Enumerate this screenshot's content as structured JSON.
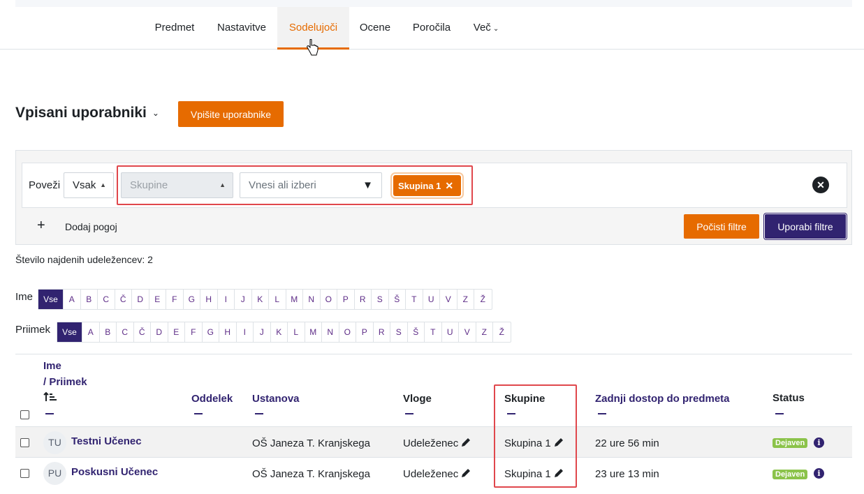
{
  "nav": {
    "tabs": [
      {
        "label": "Predmet"
      },
      {
        "label": "Nastavitve"
      },
      {
        "label": "Sodelujoči"
      },
      {
        "label": "Ocene"
      },
      {
        "label": "Poročila"
      },
      {
        "label": "Več"
      }
    ],
    "active": "Sodelujoči"
  },
  "page": {
    "title": "Vpisani uporabniki",
    "enrol_button": "Vpišite uporabnike"
  },
  "filters": {
    "match_label": "Poveži",
    "match_value": "Vsak",
    "type_value": "Skupine",
    "input_placeholder": "Vnesi ali izberi",
    "selected_chip": "Skupina 1",
    "add_condition": "Dodaj pogoj",
    "clear_button": "Počisti filtre",
    "apply_button": "Uporabi filtre"
  },
  "count_text": "Število najdenih udeležencev: 2",
  "initials": {
    "first_label": "Ime",
    "last_label": "Priimek",
    "all": "Vse",
    "letters": [
      "A",
      "B",
      "C",
      "Č",
      "D",
      "E",
      "F",
      "G",
      "H",
      "I",
      "J",
      "K",
      "L",
      "M",
      "N",
      "O",
      "P",
      "R",
      "S",
      "Š",
      "T",
      "U",
      "V",
      "Z",
      "Ž"
    ]
  },
  "table": {
    "headers": {
      "name_first": "Ime",
      "name_last": "/ Priimek",
      "department": "Oddelek",
      "institution": "Ustanova",
      "roles": "Vloge",
      "groups": "Skupine",
      "last_access": "Zadnji dostop do predmeta",
      "status": "Status"
    },
    "rows": [
      {
        "initials": "TU",
        "name": "Testni Učenec",
        "institution": "OŠ Janeza T. Kranjskega",
        "role": "Udeleženec",
        "group": "Skupina 1",
        "last_access": "22 ure 56 min",
        "status": "Dejaven"
      },
      {
        "initials": "PU",
        "name": "Poskusni Učenec",
        "institution": "OŠ Janeza T. Kranjskega",
        "role": "Udeleženec",
        "group": "Skupina 1",
        "last_access": "23 ure 13 min",
        "status": "Dejaven"
      }
    ]
  },
  "colors": {
    "accent": "#e66b00",
    "primary": "#312370",
    "badge": "#8bc34a",
    "highlight": "#e0474c"
  }
}
